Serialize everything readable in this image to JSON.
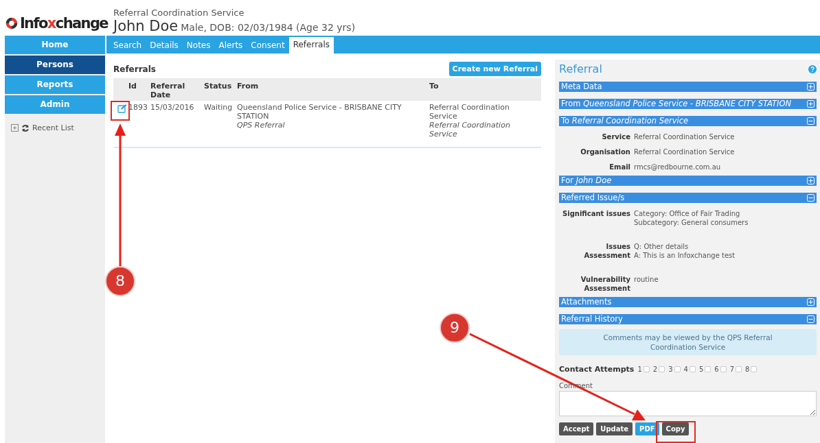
{
  "logo": {
    "parts": [
      {
        "text": "Info",
        "accent": false
      },
      {
        "text": "x",
        "accent": true
      },
      {
        "text": "change",
        "accent": false
      }
    ]
  },
  "header": {
    "service": "Referral Coordination Service",
    "person_name": "John Doe",
    "person_details": "Male, DOB: 02/03/1984 (Age 32 yrs)"
  },
  "sidebar": {
    "items": [
      {
        "label": "Home",
        "selected": false
      },
      {
        "label": "Persons",
        "selected": true
      },
      {
        "label": "Reports",
        "selected": false
      },
      {
        "label": "Admin",
        "selected": false
      }
    ],
    "recent_list": {
      "label": "Recent List"
    }
  },
  "tabs": [
    {
      "label": "Search",
      "selected": false
    },
    {
      "label": "Details",
      "selected": false
    },
    {
      "label": "Notes",
      "selected": false
    },
    {
      "label": "Alerts",
      "selected": false
    },
    {
      "label": "Consent",
      "selected": false
    },
    {
      "label": "Referrals",
      "selected": true
    }
  ],
  "referrals": {
    "title": "Referrals",
    "create_button": "Create new Referral",
    "columns": [
      "Id",
      "Referral Date",
      "Status",
      "From",
      "To"
    ],
    "rows": [
      {
        "id": "1893",
        "date": "15/03/2016",
        "status": "Waiting",
        "from": "Queensland Police Service - BRISBANE CITY STATION",
        "from_note": "QPS Referral",
        "to": "Referral Coordination Service",
        "to_note": "Referral Coordination Service"
      }
    ]
  },
  "referral_panel": {
    "title": "Referral",
    "sections": [
      {
        "label": "Meta Data",
        "expanded": false
      },
      {
        "label": "From *Queensland Police Service - BRISBANE CITY STATION*",
        "expanded": false
      },
      {
        "label": "To *Referral Coordination Service*",
        "expanded": true,
        "fields": [
          {
            "label": "Service",
            "lines": [
              "Referral Coordination Service"
            ]
          },
          {
            "label": "Organisation",
            "lines": [
              "Referral Coordination Service"
            ]
          },
          {
            "label": "Email",
            "lines": [
              "rmcs@redbourne.com.au"
            ]
          }
        ]
      },
      {
        "label": "For *John Doe*",
        "expanded": false
      },
      {
        "label": "Referred Issue/s",
        "expanded": true,
        "fields": [
          {
            "label": "Significant issues",
            "lines": [
              "Category: Office of Fair Trading",
              "Subcategory: General consumers"
            ]
          },
          {
            "label": "Issues Assessment",
            "lines": [
              "Q: Other details",
              "A: This is an Infoxchange test"
            ]
          },
          {
            "label": "Vulnerability Assessment",
            "lines": [
              "routine"
            ]
          }
        ]
      },
      {
        "label": "Attachments",
        "expanded": false
      },
      {
        "label": "Referral History",
        "expanded": true,
        "notice": "Comments may be viewed by the QPS Referral Coordination Service"
      }
    ],
    "contact_attempts": {
      "label": "Contact Attempts",
      "options": [
        {
          "number": "1",
          "checked": false
        },
        {
          "number": "2",
          "checked": false
        },
        {
          "number": "3",
          "checked": false
        },
        {
          "number": "4",
          "checked": false
        },
        {
          "number": "5",
          "checked": false
        },
        {
          "number": "6",
          "checked": false
        },
        {
          "number": "7",
          "checked": false
        },
        {
          "number": "8",
          "checked": false
        }
      ]
    },
    "comment": {
      "label": "Comment"
    },
    "buttons": [
      {
        "label": "Accept",
        "kind": "dark"
      },
      {
        "label": "Update",
        "kind": "dark"
      },
      {
        "label": "PDF",
        "kind": "primary"
      },
      {
        "label": "Copy",
        "kind": "dark"
      }
    ]
  },
  "annotations": [
    {
      "number": "8"
    },
    {
      "number": "9"
    }
  ]
}
